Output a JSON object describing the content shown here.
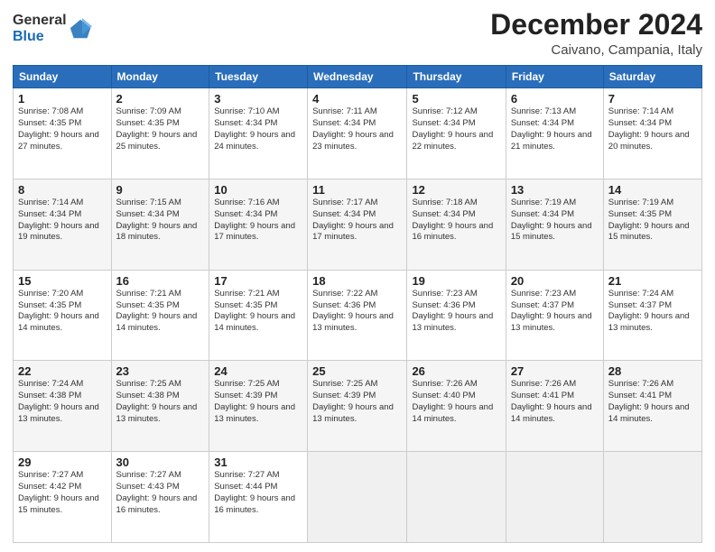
{
  "header": {
    "logo_general": "General",
    "logo_blue": "Blue",
    "month": "December 2024",
    "location": "Caivano, Campania, Italy"
  },
  "weekdays": [
    "Sunday",
    "Monday",
    "Tuesday",
    "Wednesday",
    "Thursday",
    "Friday",
    "Saturday"
  ],
  "weeks": [
    [
      {
        "day": "1",
        "sunrise": "7:08 AM",
        "sunset": "4:35 PM",
        "daylight": "9 hours and 27 minutes."
      },
      {
        "day": "2",
        "sunrise": "7:09 AM",
        "sunset": "4:35 PM",
        "daylight": "9 hours and 25 minutes."
      },
      {
        "day": "3",
        "sunrise": "7:10 AM",
        "sunset": "4:34 PM",
        "daylight": "9 hours and 24 minutes."
      },
      {
        "day": "4",
        "sunrise": "7:11 AM",
        "sunset": "4:34 PM",
        "daylight": "9 hours and 23 minutes."
      },
      {
        "day": "5",
        "sunrise": "7:12 AM",
        "sunset": "4:34 PM",
        "daylight": "9 hours and 22 minutes."
      },
      {
        "day": "6",
        "sunrise": "7:13 AM",
        "sunset": "4:34 PM",
        "daylight": "9 hours and 21 minutes."
      },
      {
        "day": "7",
        "sunrise": "7:14 AM",
        "sunset": "4:34 PM",
        "daylight": "9 hours and 20 minutes."
      }
    ],
    [
      {
        "day": "8",
        "sunrise": "7:14 AM",
        "sunset": "4:34 PM",
        "daylight": "9 hours and 19 minutes."
      },
      {
        "day": "9",
        "sunrise": "7:15 AM",
        "sunset": "4:34 PM",
        "daylight": "9 hours and 18 minutes."
      },
      {
        "day": "10",
        "sunrise": "7:16 AM",
        "sunset": "4:34 PM",
        "daylight": "9 hours and 17 minutes."
      },
      {
        "day": "11",
        "sunrise": "7:17 AM",
        "sunset": "4:34 PM",
        "daylight": "9 hours and 17 minutes."
      },
      {
        "day": "12",
        "sunrise": "7:18 AM",
        "sunset": "4:34 PM",
        "daylight": "9 hours and 16 minutes."
      },
      {
        "day": "13",
        "sunrise": "7:19 AM",
        "sunset": "4:34 PM",
        "daylight": "9 hours and 15 minutes."
      },
      {
        "day": "14",
        "sunrise": "7:19 AM",
        "sunset": "4:35 PM",
        "daylight": "9 hours and 15 minutes."
      }
    ],
    [
      {
        "day": "15",
        "sunrise": "7:20 AM",
        "sunset": "4:35 PM",
        "daylight": "9 hours and 14 minutes."
      },
      {
        "day": "16",
        "sunrise": "7:21 AM",
        "sunset": "4:35 PM",
        "daylight": "9 hours and 14 minutes."
      },
      {
        "day": "17",
        "sunrise": "7:21 AM",
        "sunset": "4:35 PM",
        "daylight": "9 hours and 14 minutes."
      },
      {
        "day": "18",
        "sunrise": "7:22 AM",
        "sunset": "4:36 PM",
        "daylight": "9 hours and 13 minutes."
      },
      {
        "day": "19",
        "sunrise": "7:23 AM",
        "sunset": "4:36 PM",
        "daylight": "9 hours and 13 minutes."
      },
      {
        "day": "20",
        "sunrise": "7:23 AM",
        "sunset": "4:37 PM",
        "daylight": "9 hours and 13 minutes."
      },
      {
        "day": "21",
        "sunrise": "7:24 AM",
        "sunset": "4:37 PM",
        "daylight": "9 hours and 13 minutes."
      }
    ],
    [
      {
        "day": "22",
        "sunrise": "7:24 AM",
        "sunset": "4:38 PM",
        "daylight": "9 hours and 13 minutes."
      },
      {
        "day": "23",
        "sunrise": "7:25 AM",
        "sunset": "4:38 PM",
        "daylight": "9 hours and 13 minutes."
      },
      {
        "day": "24",
        "sunrise": "7:25 AM",
        "sunset": "4:39 PM",
        "daylight": "9 hours and 13 minutes."
      },
      {
        "day": "25",
        "sunrise": "7:25 AM",
        "sunset": "4:39 PM",
        "daylight": "9 hours and 13 minutes."
      },
      {
        "day": "26",
        "sunrise": "7:26 AM",
        "sunset": "4:40 PM",
        "daylight": "9 hours and 14 minutes."
      },
      {
        "day": "27",
        "sunrise": "7:26 AM",
        "sunset": "4:41 PM",
        "daylight": "9 hours and 14 minutes."
      },
      {
        "day": "28",
        "sunrise": "7:26 AM",
        "sunset": "4:41 PM",
        "daylight": "9 hours and 14 minutes."
      }
    ],
    [
      {
        "day": "29",
        "sunrise": "7:27 AM",
        "sunset": "4:42 PM",
        "daylight": "9 hours and 15 minutes."
      },
      {
        "day": "30",
        "sunrise": "7:27 AM",
        "sunset": "4:43 PM",
        "daylight": "9 hours and 16 minutes."
      },
      {
        "day": "31",
        "sunrise": "7:27 AM",
        "sunset": "4:44 PM",
        "daylight": "9 hours and 16 minutes."
      },
      null,
      null,
      null,
      null
    ]
  ],
  "labels": {
    "sunrise": "Sunrise:",
    "sunset": "Sunset:",
    "daylight": "Daylight:"
  }
}
